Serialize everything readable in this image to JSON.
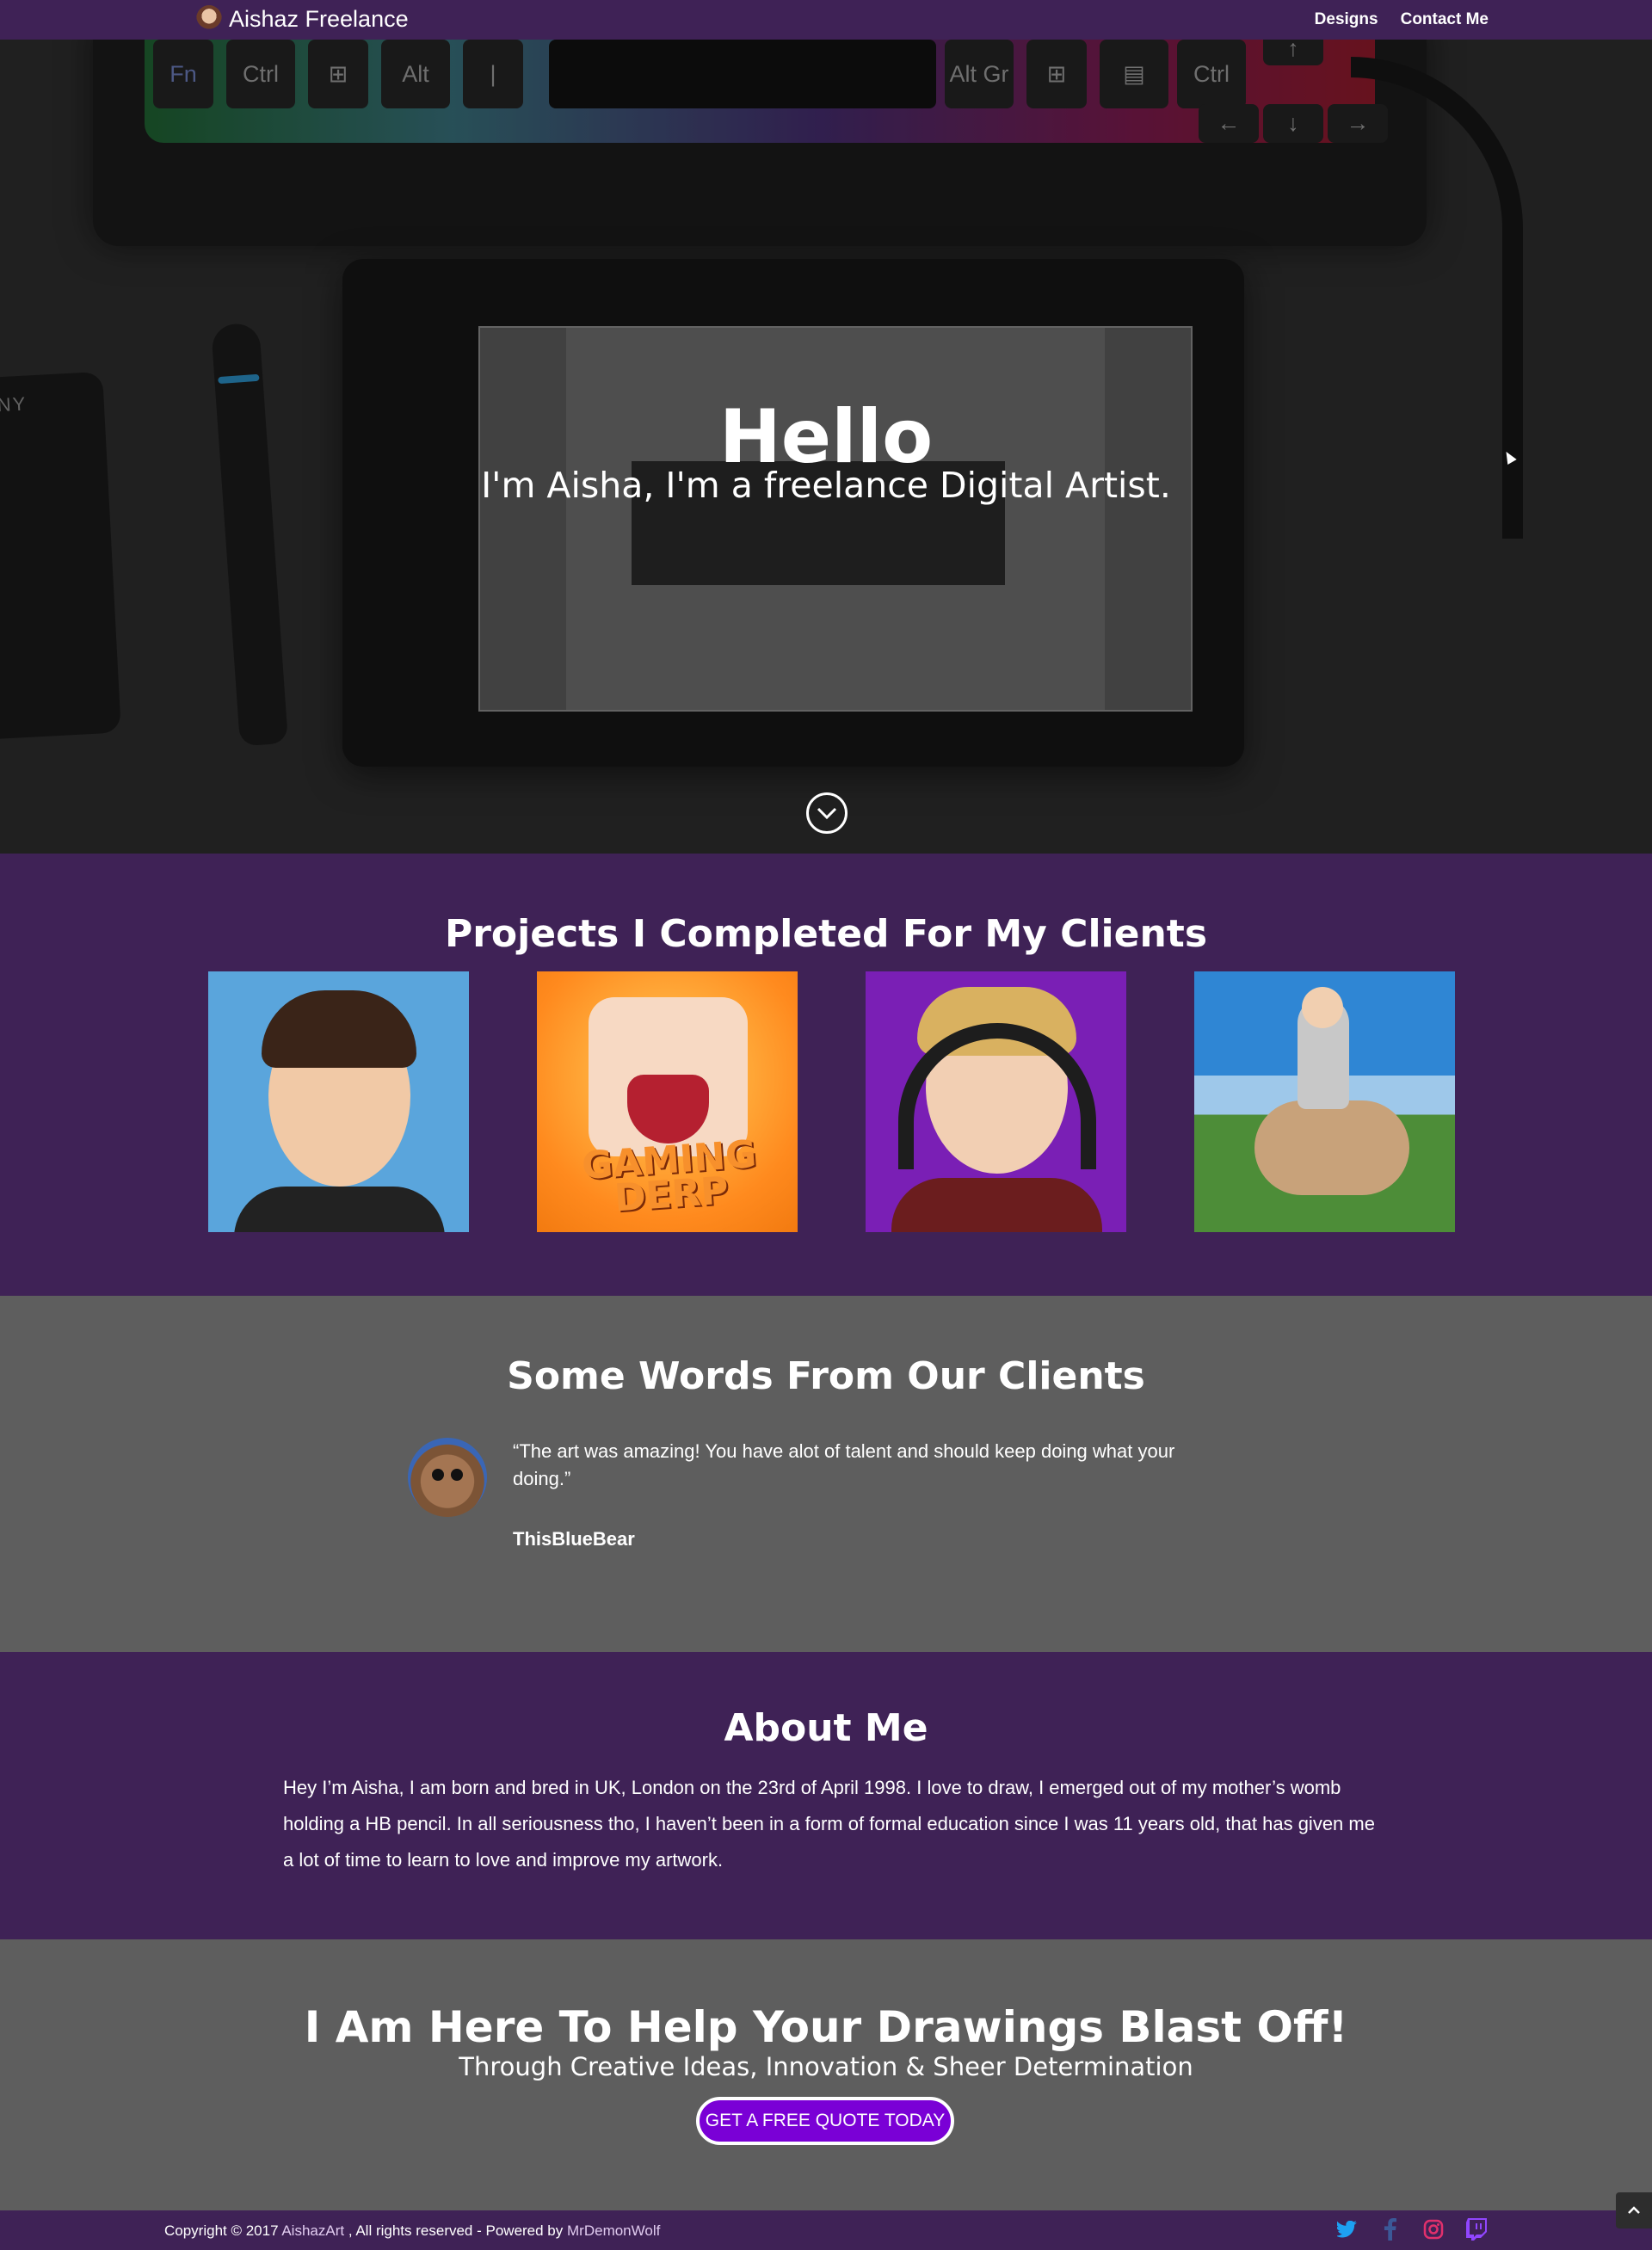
{
  "nav": {
    "brand": "Aishaz Freelance",
    "links": [
      "Designs",
      "Contact Me"
    ]
  },
  "hero": {
    "title": "Hello",
    "subtitle": "I'm Aisha, I'm a freelance Digital Artist.",
    "keys": [
      "Fn",
      "Ctrl",
      "Alt",
      "Alt Gr",
      "Ctrl"
    ],
    "phone_text": "NY"
  },
  "projects": {
    "title": "Projects I Completed For My Clients",
    "art_2_text": "GAMING DERP"
  },
  "testimonials": {
    "title": "Some Words From Our Clients",
    "quote": "“The art was amazing! You have alot of talent and should keep doing what your doing.”",
    "author": "ThisBlueBear"
  },
  "about": {
    "title": "About Me",
    "text": "Hey I’m Aisha, I am born and bred in UK, London on the 23rd of April 1998. I love to draw, I emerged out of my mother’s womb holding a HB pencil. In all seriousness tho, I haven’t been in a form of formal education since I was 11 years old, that has given me a lot of time to learn to love and improve my artwork."
  },
  "cta": {
    "title": "I Am Here To Help Your Drawings Blast Off!",
    "subtitle": "Through Creative Ideas, Innovation & Sheer Determination",
    "button": "GET A FREE QUOTE TODAY"
  },
  "footer": {
    "copyright_prefix": "Copyright © 2017",
    "owner_link": "AishazArt",
    "copyright_middle": ", All rights reserved - Powered by",
    "powered_link": "MrDemonWolf",
    "socials": [
      "twitter-icon",
      "facebook-icon",
      "instagram-icon",
      "twitch-icon"
    ]
  },
  "colors": {
    "purple": "#3f2256",
    "gray": "#5e5e5e",
    "button": "#7a00d6",
    "twitter": "#1da1f2",
    "facebook": "#3b5998",
    "instagram": "#e1306c",
    "twitch": "#9146ff"
  }
}
